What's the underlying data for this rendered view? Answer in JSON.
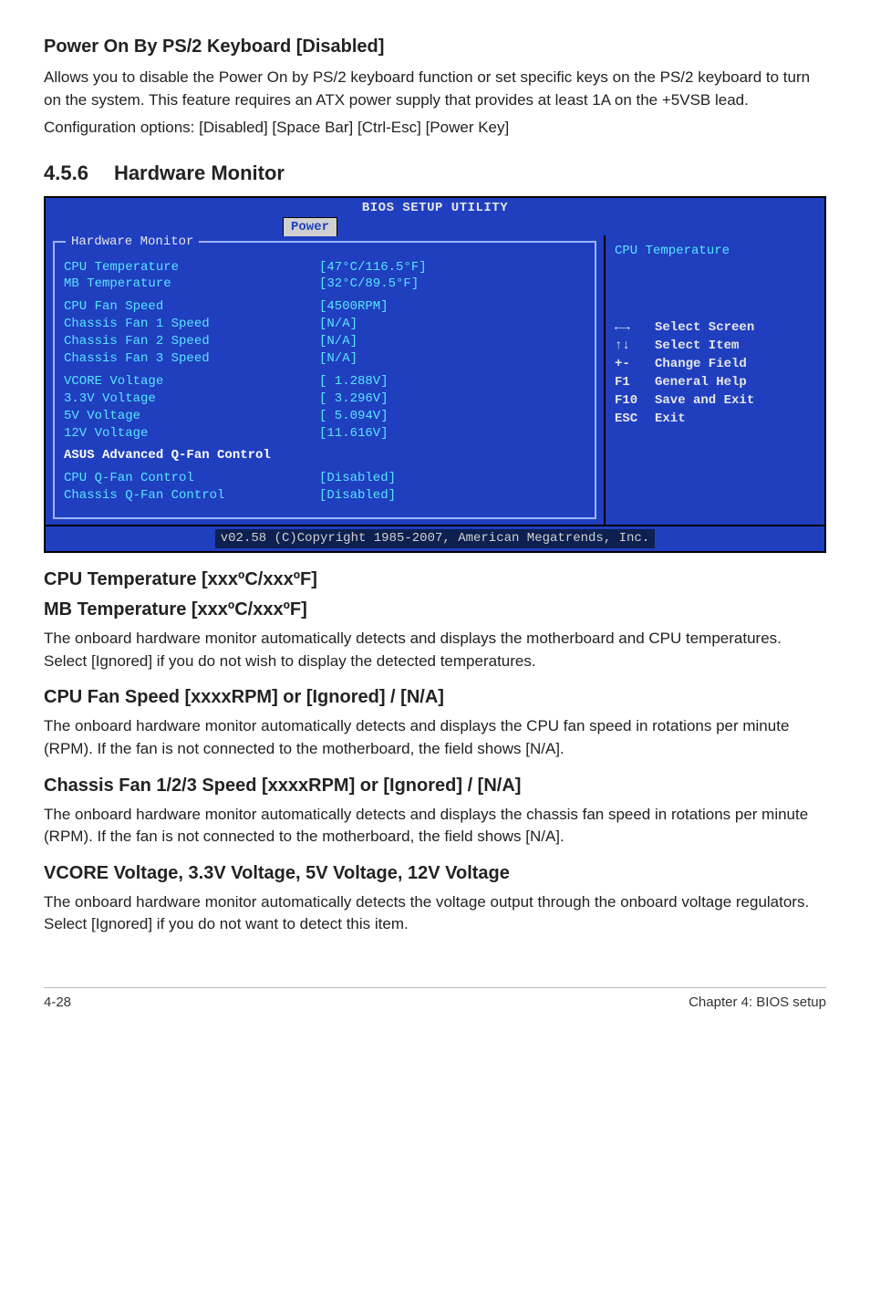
{
  "section1": {
    "title": "Power On By PS/2 Keyboard [Disabled]",
    "para1": "Allows you to disable the Power On by PS/2 keyboard function or set specific keys on the PS/2 keyboard to turn on the system. This feature requires an ATX power supply that provides at least 1A on the +5VSB lead.",
    "para2": "Configuration options: [Disabled] [Space Bar] [Ctrl-Esc] [Power Key]"
  },
  "section2": {
    "num": "4.5.6",
    "title": "Hardware Monitor"
  },
  "bios": {
    "util_title": "BIOS SETUP UTILITY",
    "tab": "Power",
    "panel_title": "Hardware Monitor",
    "rows": {
      "cpu_temp_label": "CPU Temperature",
      "cpu_temp_val": "[47°C/116.5°F]",
      "mb_temp_label": "MB Temperature",
      "mb_temp_val": "[32°C/89.5°F]",
      "cpu_fan_label": "CPU Fan Speed",
      "cpu_fan_val": "[4500RPM]",
      "ch1_label": "Chassis Fan 1 Speed",
      "ch1_val": "[N/A]",
      "ch2_label": "Chassis Fan 2 Speed",
      "ch2_val": "[N/A]",
      "ch3_label": "Chassis Fan 3 Speed",
      "ch3_val": "[N/A]",
      "vcore_label": "VCORE Voltage",
      "vcore_val": "[ 1.288V]",
      "v33_label": "3.3V  Voltage",
      "v33_val": "[ 3.296V]",
      "v5_label": "5V   Voltage",
      "v5_val": "[ 5.094V]",
      "v12_label": "12V  Voltage",
      "v12_val": "[11.616V]",
      "adv_q": "ASUS Advanced Q-Fan Control",
      "cpuq_label": "CPU Q-Fan Control",
      "cpuq_val": "[Disabled]",
      "chq_label": "Chassis Q-Fan Control",
      "chq_val": "[Disabled]"
    },
    "right": {
      "title": "CPU Temperature",
      "hints": [
        {
          "key": "←→",
          "text": "Select Screen"
        },
        {
          "key": "↑↓",
          "text": "Select Item"
        },
        {
          "key": "+-",
          "text": "Change Field"
        },
        {
          "key": "F1",
          "text": "General Help"
        },
        {
          "key": "F10",
          "text": "Save and Exit"
        },
        {
          "key": "ESC",
          "text": "Exit"
        }
      ]
    },
    "footer": "v02.58 (C)Copyright 1985-2007, American Megatrends, Inc."
  },
  "section3": {
    "title1": "CPU Temperature [xxxºC/xxxºF]",
    "title2": "MB Temperature [xxxºC/xxxºF]",
    "para": "The onboard hardware monitor automatically detects and displays the motherboard and CPU temperatures. Select [Ignored] if you do not wish to display the detected temperatures."
  },
  "section4": {
    "title": "CPU Fan Speed [xxxxRPM] or [Ignored] / [N/A]",
    "para": "The onboard hardware monitor automatically detects and displays the CPU fan speed in rotations per minute (RPM). If the fan is not connected to the motherboard, the field shows [N/A]."
  },
  "section5": {
    "title": "Chassis Fan 1/2/3 Speed [xxxxRPM] or [Ignored] / [N/A]",
    "para": "The onboard hardware monitor automatically detects and displays the chassis fan speed in rotations per minute (RPM). If the fan is not connected to the motherboard, the field shows [N/A]."
  },
  "section6": {
    "title": "VCORE Voltage, 3.3V Voltage, 5V Voltage, 12V Voltage",
    "para": "The onboard hardware monitor automatically detects the voltage output through the onboard voltage regulators. Select [Ignored] if you do not want to detect this item."
  },
  "footer": {
    "left": "4-28",
    "right": "Chapter 4: BIOS setup"
  }
}
